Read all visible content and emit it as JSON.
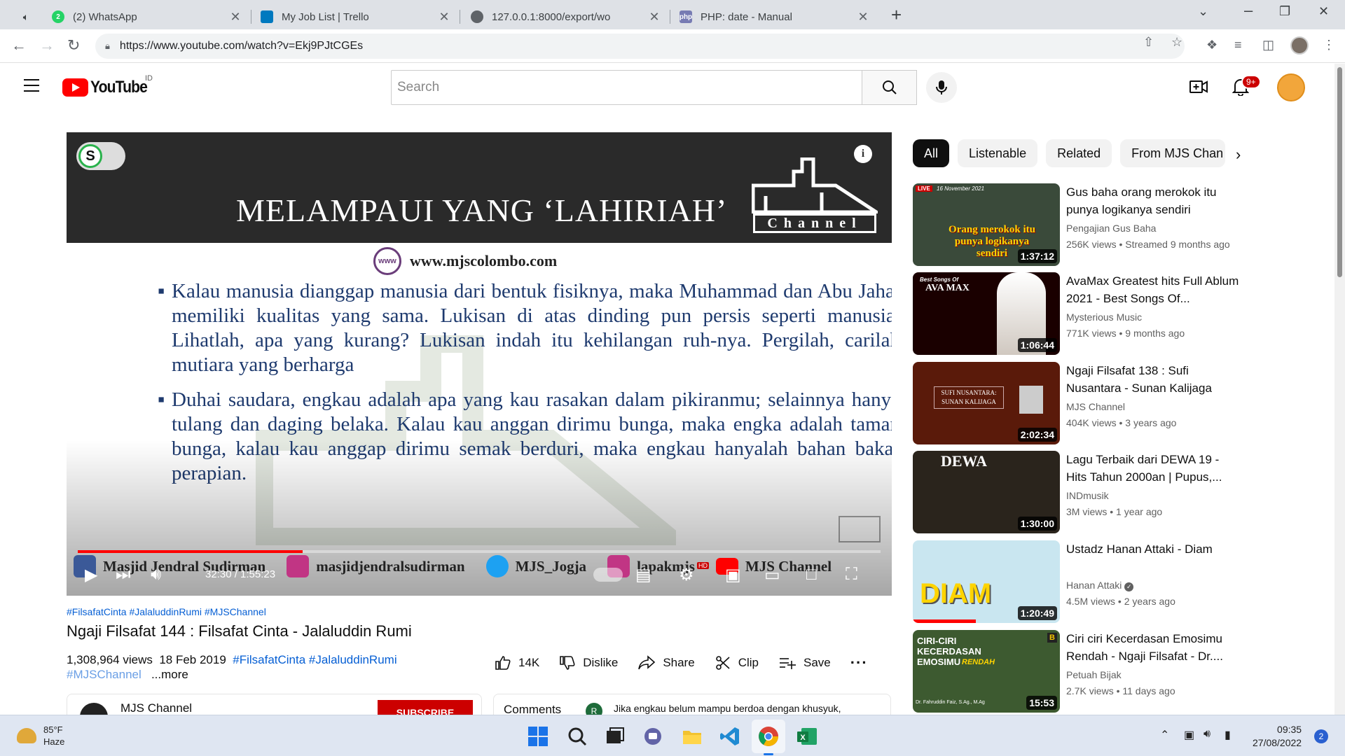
{
  "browser": {
    "tabs": [
      {
        "title": "(2) WhatsApp",
        "icon": "whatsapp-icon",
        "badge": "2"
      },
      {
        "title": "My Job List | Trello",
        "icon": "trello-icon"
      },
      {
        "title": "127.0.0.1:8000/export/wo",
        "icon": "globe-icon"
      },
      {
        "title": "PHP: date - Manual",
        "icon": "php-icon",
        "icon_text": "php"
      }
    ],
    "url": "https://www.youtube.com/watch?v=Ekj9PJtCGEs"
  },
  "youtube": {
    "country_code": "ID",
    "logo_text": "YouTube",
    "search_placeholder": "Search",
    "notification_count": "9+"
  },
  "player": {
    "slide_title": "MELAMPAUI YANG ‘LAHIRIAH’",
    "brand_caption": "Channel",
    "toggle_letter": "S",
    "info_letter": "i",
    "globe_label": "www",
    "website": "www.mjscolombo.com",
    "paragraphs": [
      "Kalau manusia dianggap manusia dari bentuk fisiknya, maka Muhammad dan Abu Jahal memiliki kualitas yang sama. Lukisan di atas dinding pun persis seperti manusia. Lihatlah, apa yang kurang? Lukisan indah itu kehilangan ruh-nya. Pergilah, carilah mutiara yang berharga",
      "Duhai saudara, engkau adalah apa yang kau rasakan dalam pikiranmu; selainnya hanya tulang dan daging belaka. Kalau kau anggan dirimu bunga, maka engka adalah taman bunga, kalau kau anggap dirimu semak berduri, maka engkau hanyalah bahan bakar perapian."
    ],
    "socials": [
      {
        "name": "Masjid Jendral Sudirman",
        "icon": "facebook-icon",
        "color": "#3b5998"
      },
      {
        "name": "masjidjendralsudirman",
        "icon": "instagram-icon",
        "color": "#c13584"
      },
      {
        "name": "MJS_Jogja",
        "icon": "twitter-icon",
        "color": "#1da1f2"
      },
      {
        "name": "lapakmjs",
        "icon": "instagram-icon",
        "color": "#c13584"
      },
      {
        "name": "MJS Channel",
        "icon": "youtube-icon",
        "color": "#ff0000"
      }
    ],
    "time_current": "32:30",
    "time_total": "1:55:23",
    "time_display": "32:30 / 1:55:23",
    "progress_fraction": 0.28,
    "hd_badge": "HD"
  },
  "video": {
    "hashtags_top": "#FilsafatCinta #JalaluddinRumi #MJSChannel",
    "title": "Ngaji Filsafat 144 : Filsafat Cinta - Jalaluddin Rumi",
    "views": "1,308,964 views",
    "date": "18 Feb 2019",
    "desc_hashtags": "#FilsafatCinta #JalaluddinRumi",
    "desc_hashtags2": "#MJSChannel",
    "more": "...more",
    "likes": "14K",
    "dislike": "Dislike",
    "share": "Share",
    "clip": "Clip",
    "save": "Save",
    "channel": "MJS Channel",
    "subscribe": "SUBSCRIBE",
    "comments_label": "Comments",
    "comment_avatar": "R",
    "comment_preview": "Jika engkau belum mampu berdoa dengan khusyuk,"
  },
  "chips": [
    "All",
    "Listenable",
    "Related",
    "From MJS Chan"
  ],
  "recommendations": [
    {
      "title": "Gus baha orang merokok itu punya logikanya sendiri",
      "channel": "Pengajian Gus Baha",
      "meta": "256K views • Streamed 9 months ago",
      "duration": "1:37:12",
      "thumb_text": "Orang merokok itu punya logikanya sendiri",
      "live_label": "LIVE",
      "live_date": "16 November 2021"
    },
    {
      "title": "AvaMax Greatest hits Full Ablum 2021 - Best Songs Of...",
      "channel": "Mysterious Music",
      "meta": "771K views • 9 months ago",
      "duration": "1:06:44",
      "thumb_text": "AVA MAX",
      "thumb_sub": "Best Songs Of"
    },
    {
      "title": "Ngaji Filsafat 138 : Sufi Nusantara - Sunan Kalijaga",
      "channel": "MJS Channel",
      "meta": "404K views • 3 years ago",
      "duration": "2:02:34",
      "thumb_text": "SUFI NUSANTARA: SUNAN KALIJAGA"
    },
    {
      "title": "Lagu Terbaik dari DEWA 19 - Hits Tahun 2000an | Pupus,...",
      "channel": "INDmusik",
      "meta": "3M views • 1 year ago",
      "duration": "1:30:00",
      "thumb_text": "DEWA"
    },
    {
      "title": "Ustadz Hanan Attaki - Diam",
      "channel": "Hanan Attaki",
      "meta": "4.5M views • 2 years ago",
      "duration": "1:20:49",
      "thumb_text": "DIAM",
      "verified": true
    },
    {
      "title": "Ciri ciri Kecerdasan Emosimu Rendah - Ngaji Filsafat - Dr....",
      "channel": "Petuah Bijak",
      "meta": "2.7K views • 11 days ago",
      "duration": "15:53",
      "thumb_text": "CIRI-CIRI KECERDASAN EMOSIMU",
      "thumb_sub": "RENDAH",
      "thumb_badge": "B",
      "thumb_footer": "Dr. Fahruddin Faiz, S.Ag., M.Ag"
    }
  ],
  "taskbar": {
    "temperature": "85°F",
    "weather": "Haze",
    "time": "09:35",
    "date": "27/08/2022",
    "notifications": "2"
  }
}
